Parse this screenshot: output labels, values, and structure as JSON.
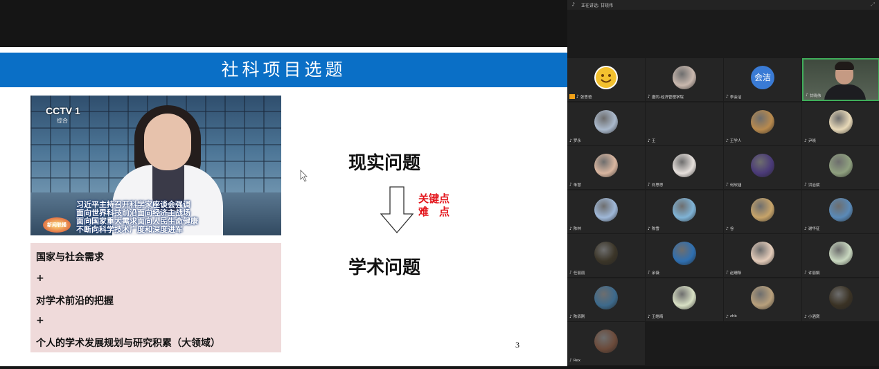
{
  "slide": {
    "title": "社科项目选题",
    "news_image": {
      "channel_logo": "CCTV 1",
      "channel_sub": "综合",
      "program_logo": "新闻联播",
      "caption_lines": [
        "习近平主持召开科学家座谈会强调",
        "面向世界科技前沿面向经济主战场",
        "面向国家重大需求面向人民生命健康",
        "不断向科学技术广度和深度进军"
      ]
    },
    "pink_box_lines": [
      "国家与社会需求",
      "+",
      "对学术前沿的把握",
      "+",
      "个人的学术发展规划与研究积累（大领域）"
    ],
    "reality_problem": "现实问题",
    "key_points_line1": "关键点",
    "key_points_line2": "难　点",
    "academic_problem": "学术问题",
    "page_number": "3"
  },
  "meeting": {
    "speaking_label": "正在讲话:",
    "speaking_name": "甘晓伟",
    "participants": [
      {
        "name": "张思语",
        "avatar": "smiley",
        "color": "#f3c12f",
        "host": true
      },
      {
        "name": "唐同-经济管理学院",
        "avatar": "photo",
        "color": "#c9b8ae"
      },
      {
        "name": "李会洁",
        "avatar": "text",
        "text": "会洁",
        "color": "#3a7bd5"
      },
      {
        "name": "甘晓伟",
        "avatar": "video",
        "color": "#4d5a4a",
        "active": true
      },
      {
        "name": "罗永",
        "avatar": "photo",
        "color": "#aab9cc"
      },
      {
        "name": "王",
        "avatar": "none",
        "color": "#252525"
      },
      {
        "name": "王学人",
        "avatar": "photo",
        "color": "#b88a4e"
      },
      {
        "name": "尹晓",
        "avatar": "photo",
        "color": "#e8d9b8"
      },
      {
        "name": "朱慧",
        "avatar": "photo",
        "color": "#d9b6a0"
      },
      {
        "name": "刘思思",
        "avatar": "photo",
        "color": "#e6e0dc"
      },
      {
        "name": "何欣涵",
        "avatar": "photo",
        "color": "#4a3a78"
      },
      {
        "name": "洪治斌",
        "avatar": "photo",
        "color": "#8fa07f"
      },
      {
        "name": "陈林",
        "avatar": "photo",
        "color": "#9fb8d8"
      },
      {
        "name": "陈雪",
        "avatar": "photo",
        "color": "#7fb3d6"
      },
      {
        "name": "谷",
        "avatar": "photo",
        "color": "#c7a46a"
      },
      {
        "name": "谢华征",
        "avatar": "photo",
        "color": "#5a8ab8"
      },
      {
        "name": "任丽丽",
        "avatar": "photo",
        "color": "#3b3528"
      },
      {
        "name": "余薇",
        "avatar": "photo",
        "color": "#2f6fb0"
      },
      {
        "name": "赵珊阳",
        "avatar": "photo",
        "color": "#e3cbb9"
      },
      {
        "name": "许丽娟",
        "avatar": "photo",
        "color": "#c9d8c0"
      },
      {
        "name": "陈佰刚",
        "avatar": "photo",
        "color": "#3d6a8c"
      },
      {
        "name": "王皓晴",
        "avatar": "photo",
        "color": "#d8e0c4"
      },
      {
        "name": "zhb",
        "avatar": "photo",
        "color": "#b8a07c"
      },
      {
        "name": "小酒窝",
        "avatar": "photo",
        "color": "#3a3224"
      },
      {
        "name": "Rex",
        "avatar": "photo",
        "color": "#6b4a3a"
      }
    ]
  }
}
